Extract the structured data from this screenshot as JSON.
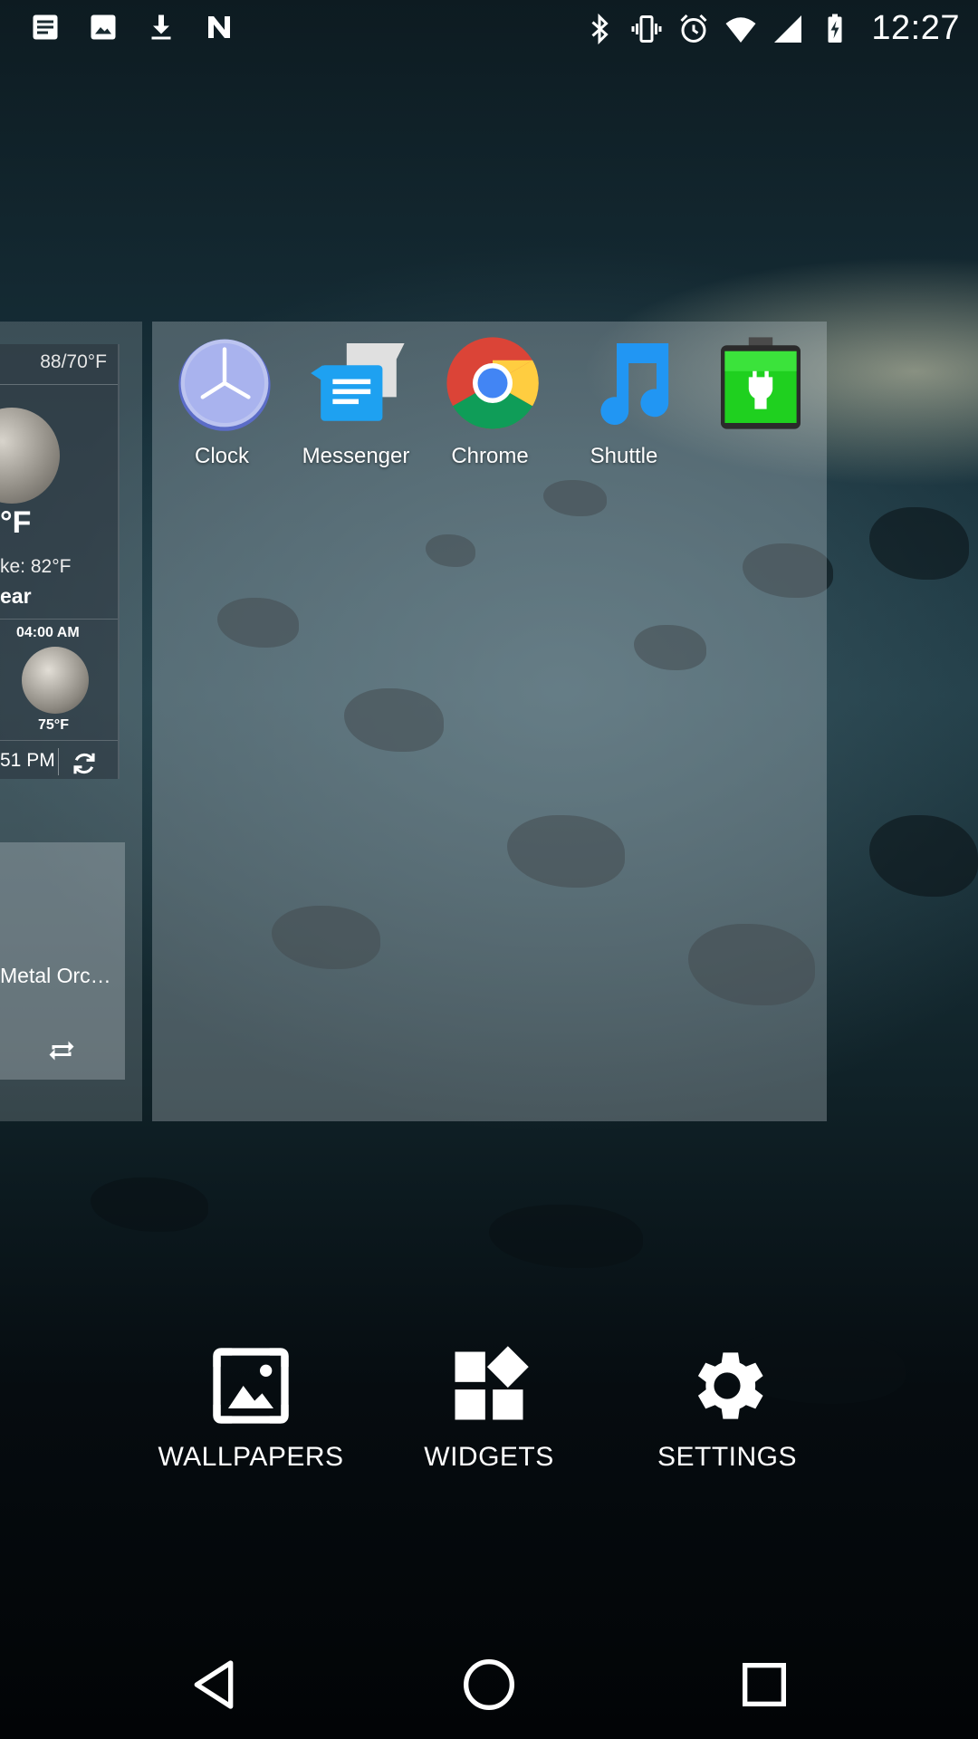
{
  "status_bar": {
    "time": "12:27",
    "left_icons": [
      "notes-icon",
      "image-icon",
      "download-icon",
      "n-logo-icon"
    ],
    "right_icons": [
      "bluetooth-icon",
      "vibrate-icon",
      "alarm-icon",
      "wifi-icon",
      "signal-icon",
      "battery-charging-icon"
    ]
  },
  "weather_widget": {
    "hi_lo": "88/70°F",
    "current_temp": "°F",
    "feels_like": "ke: 82°F",
    "condition": "ear",
    "forecast_time": "04:00 AM",
    "forecast_temp": "75°F",
    "updated": "51 PM"
  },
  "music_widget": {
    "track": "Metal Orc…"
  },
  "apps": [
    {
      "label": "Clock",
      "icon": "clock-icon"
    },
    {
      "label": "Messenger",
      "icon": "messenger-icon"
    },
    {
      "label": "Chrome",
      "icon": "chrome-icon"
    },
    {
      "label": "Shuttle",
      "icon": "music-note-icon"
    },
    {
      "label": "",
      "icon": "battery-app-icon"
    }
  ],
  "options": {
    "wallpapers": "WALLPAPERS",
    "widgets": "WIDGETS",
    "settings": "SETTINGS"
  },
  "nav": [
    "back-icon",
    "home-icon",
    "recents-icon"
  ]
}
